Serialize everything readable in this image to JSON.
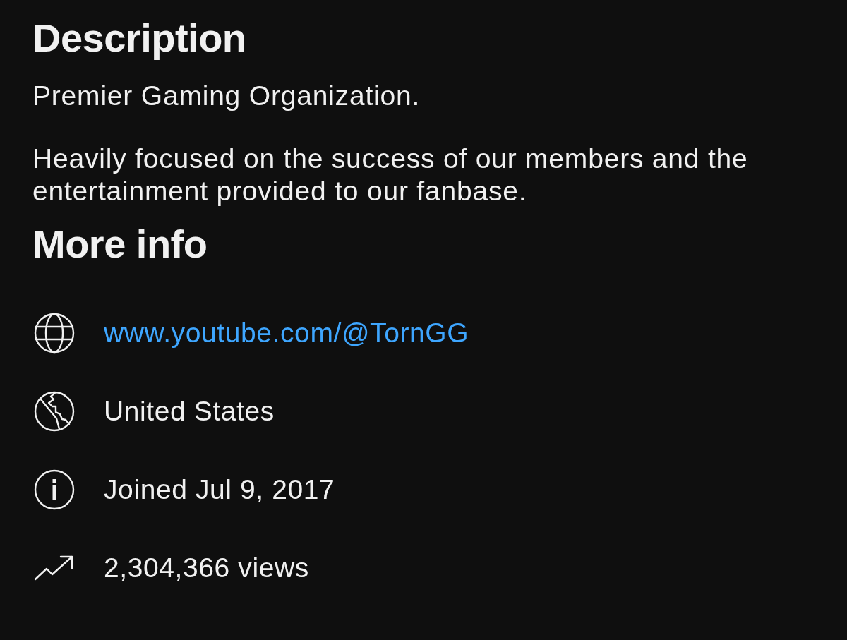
{
  "description": {
    "title": "Description",
    "paragraphs": [
      "Premier Gaming Organization.",
      "Heavily focused on the success of our members and the entertainment provided to our fanbase."
    ]
  },
  "more_info": {
    "title": "More info",
    "items": [
      {
        "kind": "link",
        "text": "www.youtube.com/@TornGG"
      },
      {
        "kind": "text",
        "text": "United States"
      },
      {
        "kind": "text",
        "text": "Joined Jul 9, 2017"
      },
      {
        "kind": "text",
        "text": "2,304,366 views"
      }
    ]
  }
}
